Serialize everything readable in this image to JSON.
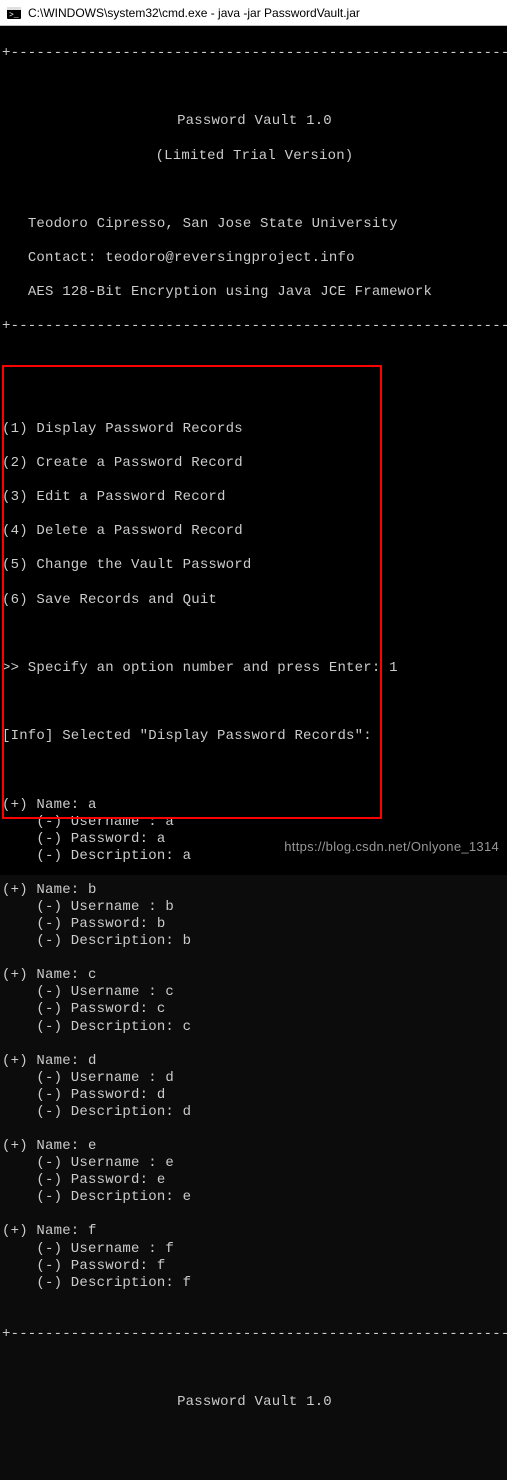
{
  "window": {
    "title": "C:\\WINDOWS\\system32\\cmd.exe - java  -jar PasswordVault.jar"
  },
  "banner": {
    "rule": "+------------------------------------------------------------+",
    "title": "Password Vault 1.0",
    "subtitle": "(Limited Trial Version)",
    "author": "Teodoro Cipresso, San Jose State University",
    "contact": "Contact: teodoro@reversingproject.info",
    "crypto": "AES 128-Bit Encryption using Java JCE Framework"
  },
  "menu": {
    "items": [
      "(1) Display Password Records",
      "(2) Create a Password Record",
      "(3) Edit a Password Record",
      "(4) Delete a Password Record",
      "(5) Change the Vault Password",
      "(6) Save Records and Quit"
    ],
    "prompt_label": ">> Specify an option number and press Enter:",
    "prompt_value": "1"
  },
  "info": {
    "line": "[Info] Selected \"Display Password Records\":"
  },
  "records": [
    {
      "name": "a",
      "username": "a",
      "password": "a",
      "description": "a"
    },
    {
      "name": "b",
      "username": "b",
      "password": "b",
      "description": "b"
    },
    {
      "name": "c",
      "username": "c",
      "password": "c",
      "description": "c"
    },
    {
      "name": "d",
      "username": "d",
      "password": "d",
      "description": "d"
    },
    {
      "name": "e",
      "username": "e",
      "password": "e",
      "description": "e"
    },
    {
      "name": "f",
      "username": "f",
      "password": "f",
      "description": "f"
    }
  ],
  "record_labels": {
    "name": "(+) Name: ",
    "username": "    (-) Username : ",
    "password": "    (-) Password: ",
    "description": "    (-) Description: "
  },
  "footer": {
    "title": "Password Vault 1.0"
  },
  "watermark": "https://blog.csdn.net/Onlyone_1314",
  "colors": {
    "terminal_bg": "#000000",
    "terminal_fg": "#cccccc",
    "highlight": "#ff0000"
  }
}
